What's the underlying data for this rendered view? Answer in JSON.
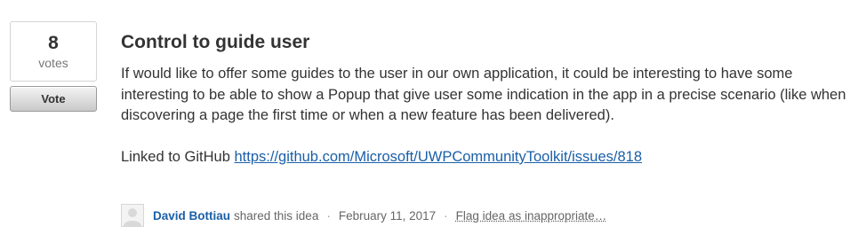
{
  "vote": {
    "count": "8",
    "label": "votes",
    "button_label": "Vote"
  },
  "idea": {
    "title": "Control to guide user",
    "body": "If would like to offer some guides to the user in our own application, it could be interesting to have some interesting to be able to show a Popup that give user some indication in the app in a precise scenario (like when discovering a page the first time or when a new feature has been delivered).",
    "linked_prefix": "Linked to GitHub",
    "github_url": "https://github.com/Microsoft/UWPCommunityToolkit/issues/818"
  },
  "meta": {
    "avatar_icon": "default-user-avatar-icon",
    "author": "David Bottiau",
    "action": "shared this idea",
    "separator": "·",
    "date": "February 11, 2017",
    "flag_label": "Flag idea as inappropriate…"
  },
  "colors": {
    "link": "#1a5fa8",
    "text": "#333333",
    "muted": "#666666"
  }
}
